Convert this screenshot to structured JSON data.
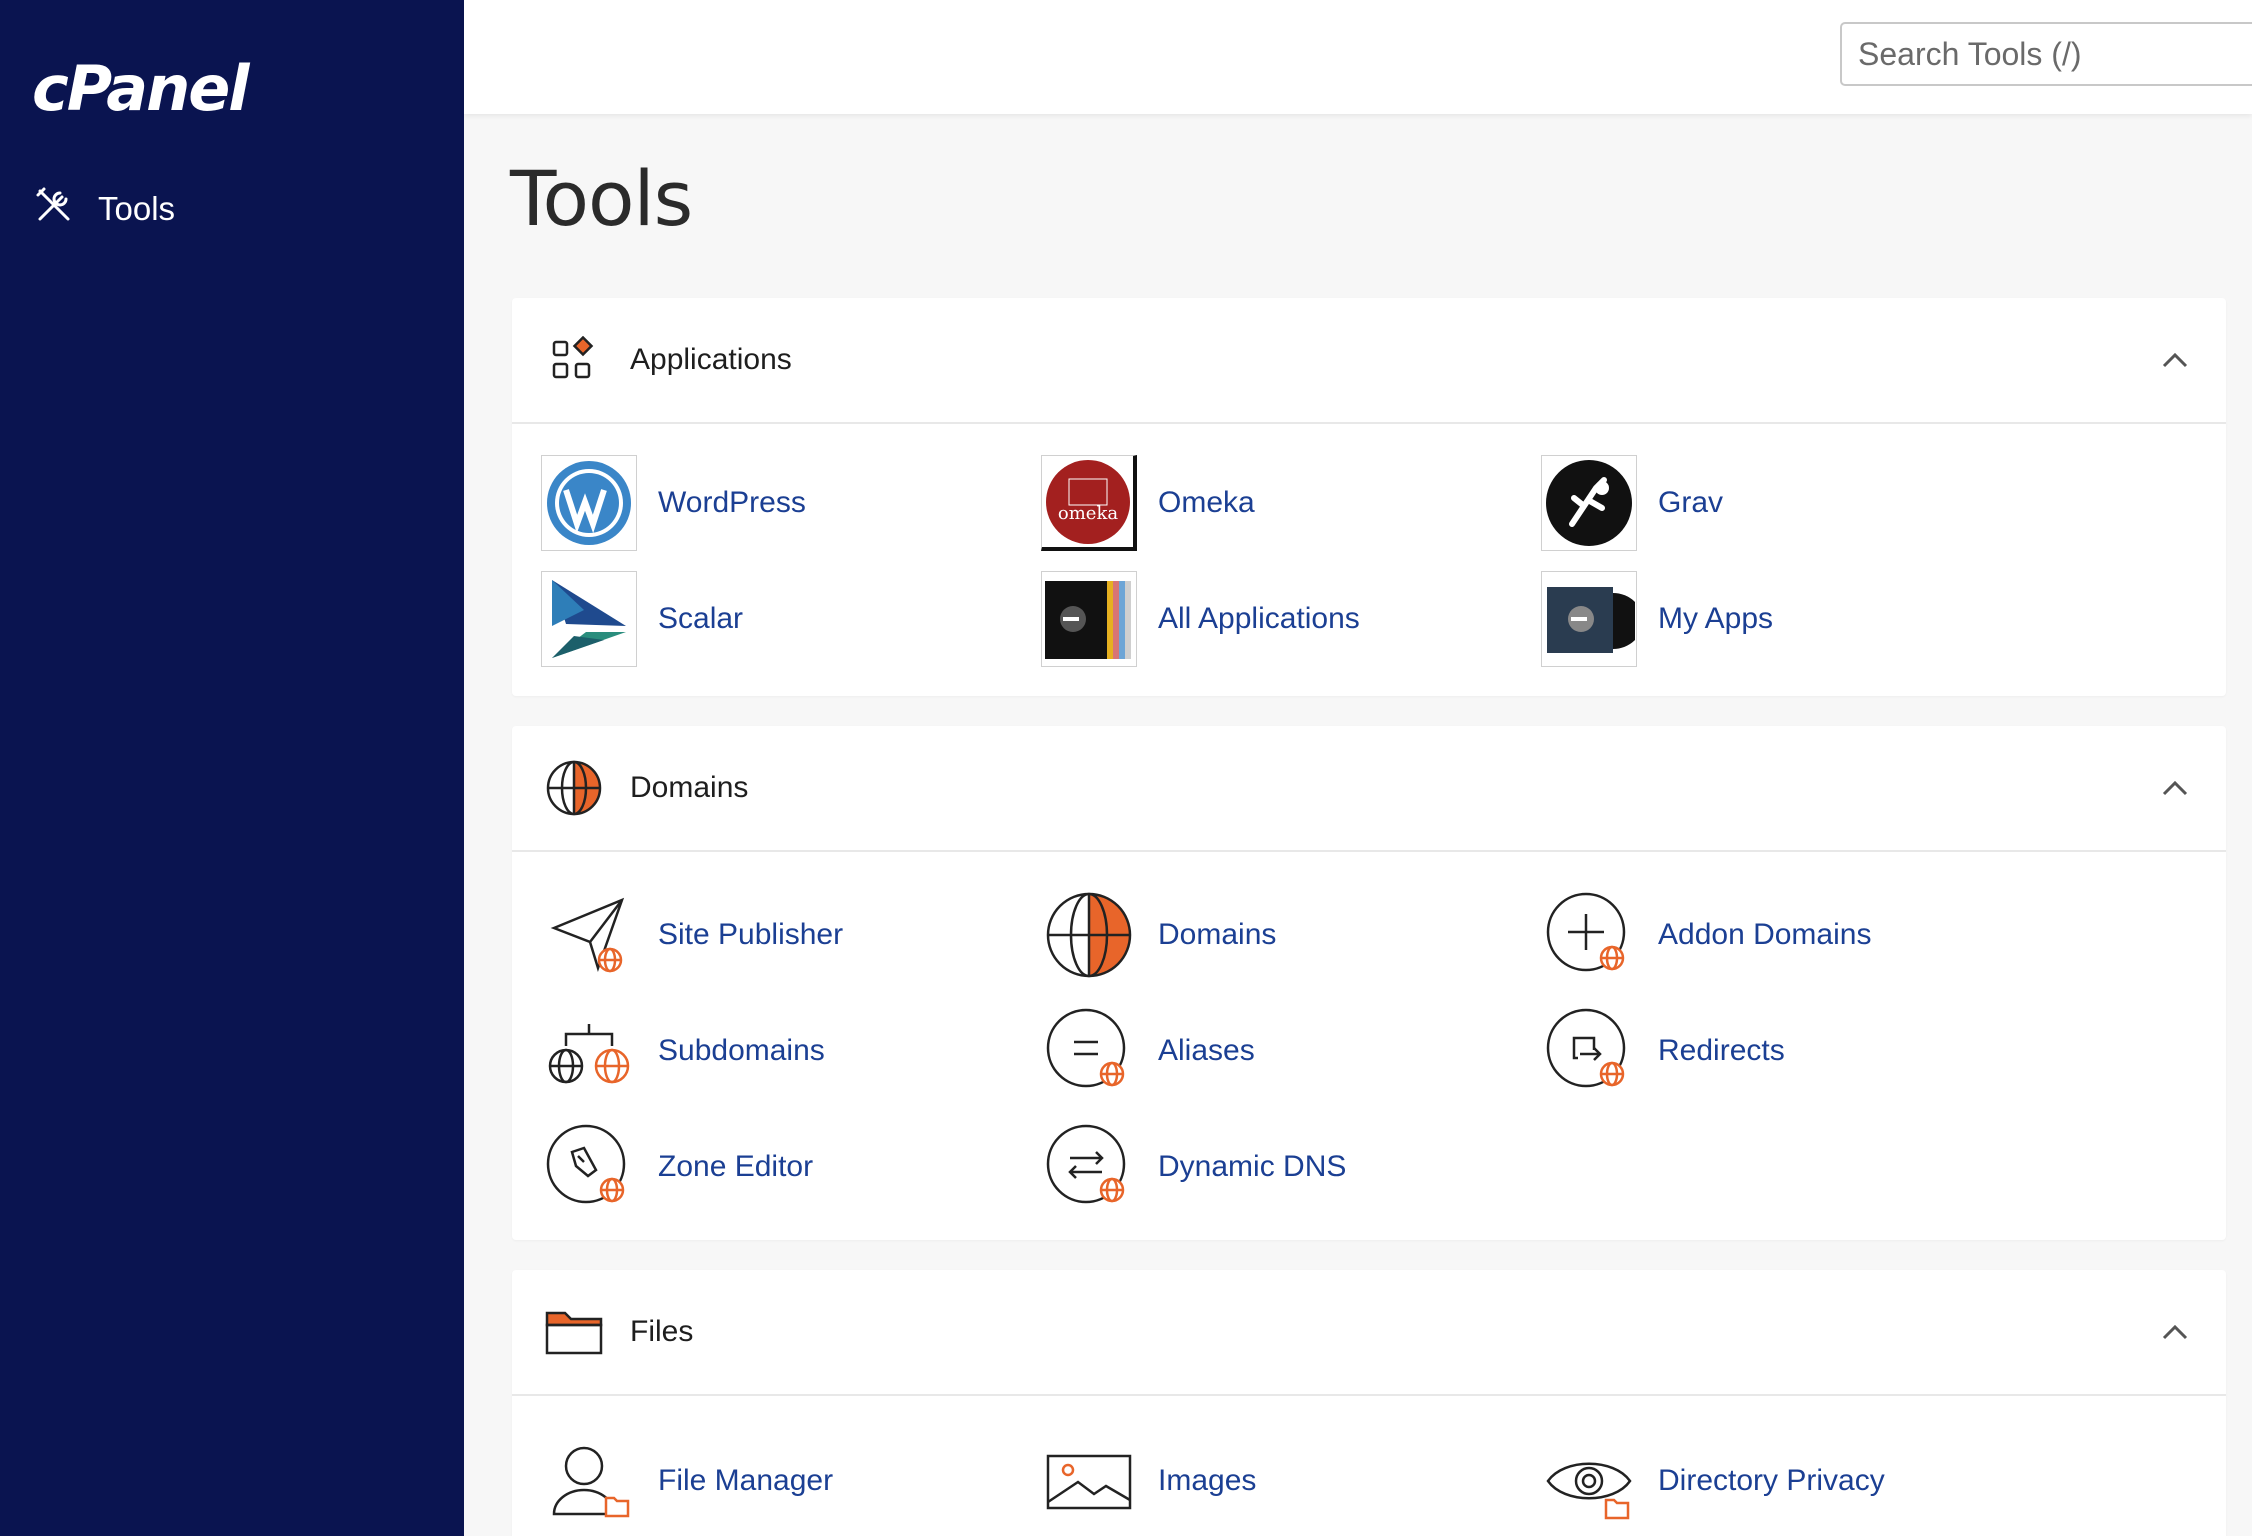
{
  "app": {
    "logo_text": "cPanel",
    "nav_tools_label": "Tools"
  },
  "search": {
    "placeholder": "Search Tools (/)"
  },
  "page": {
    "title": "Tools"
  },
  "colors": {
    "sidebar": "#0a1450",
    "link": "#1b3f93",
    "accent_orange": "#e8652a"
  },
  "sections": {
    "applications": {
      "title": "Applications",
      "items": {
        "wordpress": "WordPress",
        "omeka": "Omeka",
        "omeka_logo": "omeka",
        "grav": "Grav",
        "scalar": "Scalar",
        "all_applications": "All Applications",
        "my_apps": "My Apps"
      }
    },
    "domains": {
      "title": "Domains",
      "items": {
        "site_publisher": "Site Publisher",
        "domains": "Domains",
        "addon_domains": "Addon Domains",
        "subdomains": "Subdomains",
        "aliases": "Aliases",
        "redirects": "Redirects",
        "zone_editor": "Zone Editor",
        "dynamic_dns": "Dynamic DNS"
      }
    },
    "files": {
      "title": "Files",
      "items": {
        "file_manager": "File Manager",
        "images": "Images",
        "directory_privacy": "Directory Privacy"
      }
    }
  }
}
